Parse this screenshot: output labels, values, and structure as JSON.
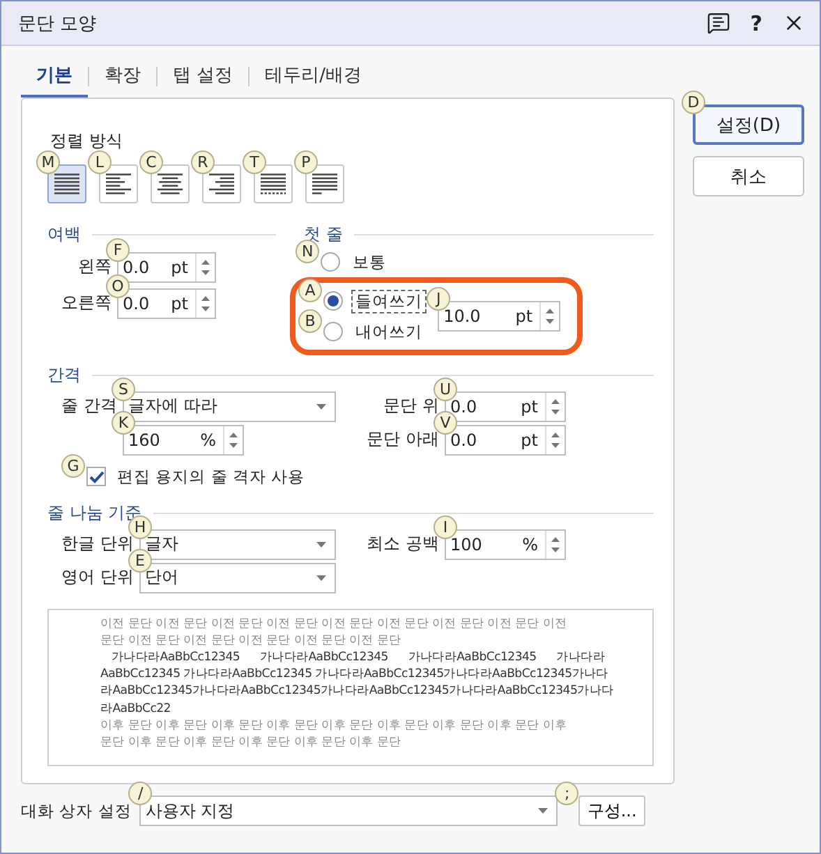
{
  "window": {
    "title": "문단 모양",
    "help": "?"
  },
  "tabs": [
    {
      "label": "기본",
      "selected": true
    },
    {
      "label": "확장",
      "selected": false
    },
    {
      "label": "탭 설정",
      "selected": false
    },
    {
      "label": "테두리/배경",
      "selected": false
    }
  ],
  "buttons": [
    {
      "label": "설정(D)",
      "key_tip": "D",
      "default": true
    },
    {
      "label": "취소",
      "default": false
    }
  ],
  "alignment": {
    "label": "정렬 방식",
    "options": [
      {
        "kind": "justify",
        "key_tip": "M",
        "selected": true
      },
      {
        "kind": "left",
        "key_tip": "L",
        "selected": false
      },
      {
        "kind": "center",
        "key_tip": "C",
        "selected": false
      },
      {
        "kind": "right",
        "key_tip": "R",
        "selected": false
      },
      {
        "kind": "distribute",
        "key_tip": "T",
        "selected": false
      },
      {
        "kind": "divide",
        "key_tip": "P",
        "selected": false
      }
    ]
  },
  "margin": {
    "title": "여백",
    "fields": [
      {
        "label": "왼쪽",
        "key_tip": "F",
        "value": "0.0",
        "unit": "pt"
      },
      {
        "label": "오른쪽",
        "key_tip": "O",
        "value": "0.0",
        "unit": "pt"
      }
    ]
  },
  "first_line": {
    "title": "첫 줄",
    "highlighted": true,
    "options": [
      {
        "label": "보통",
        "key_tip": "N",
        "selected": false,
        "focused": false
      },
      {
        "label": "들여쓰기",
        "key_tip": "A",
        "selected": true,
        "focused": true
      },
      {
        "label": "내어쓰기",
        "key_tip": "B",
        "selected": false,
        "focused": false
      }
    ],
    "amount": {
      "key_tip": "J",
      "value": "10.0",
      "unit": "pt"
    }
  },
  "spacing": {
    "title": "간격",
    "line_spacing": {
      "label": "줄 간격",
      "key_tip": "S",
      "value": "글자에 따라"
    },
    "line_spacing_amount": {
      "key_tip": "K",
      "value": "160",
      "unit": "%"
    },
    "above": {
      "label": "문단 위",
      "key_tip": "U",
      "value": "0.0",
      "unit": "pt"
    },
    "below": {
      "label": "문단 아래",
      "key_tip": "V",
      "value": "0.0",
      "unit": "pt"
    },
    "grid": {
      "label": "편집 용지의 줄 격자 사용",
      "key_tip": "G",
      "checked": true
    }
  },
  "line_break": {
    "title": "줄 나눔 기준",
    "korean": {
      "label": "한글 단위",
      "key_tip": "H",
      "value": "글자"
    },
    "english": {
      "label": "영어 단위",
      "key_tip": "E",
      "value": "단어"
    },
    "min_space": {
      "label": "최소 공백",
      "key_tip": "I",
      "value": "100",
      "unit": "%"
    }
  },
  "preview": {
    "lines": [
      {
        "kind": "context",
        "text": "이전 문단 이전 문단 이전 문단 이전 문단 이전 문단 이전 문단 이전 문단 이전 문단 이전"
      },
      {
        "kind": "context",
        "text": "문단 이전 문단 이전 문단 이전 문단 이전 문단 이전 문단"
      },
      {
        "kind": "sample",
        "text": "가나다라AaBbCc12345 가나다라AaBbCc12345 가나다라AaBbCc12345 가나다라"
      },
      {
        "kind": "sample",
        "text": "AaBbCc12345 가나다라AaBbCc12345 가나다라AaBbCc12345가나다라AaBbCc12345가나다"
      },
      {
        "kind": "sample",
        "text": "라AaBbCc12345가나다라AaBbCc12345가나다라AaBbCc12345가나다라AaBbCc12345가나다"
      },
      {
        "kind": "sample",
        "text": "라AaBbCc22"
      },
      {
        "kind": "context",
        "text": "이후 문단 이후 문단 이후 문단 이후 문단 이후 문단 이후 문단 이후 문단 이후 문단 이후"
      },
      {
        "kind": "context",
        "text": "문단 이후 문단 이후 문단 이후 문단 이후 문단 이후 문단"
      }
    ]
  },
  "footer": {
    "label": "대화 상자 설정",
    "preset": {
      "key_tip": "/",
      "value": "사용자 지정"
    },
    "button": {
      "label": "구성...",
      "key_tip": ";"
    }
  }
}
